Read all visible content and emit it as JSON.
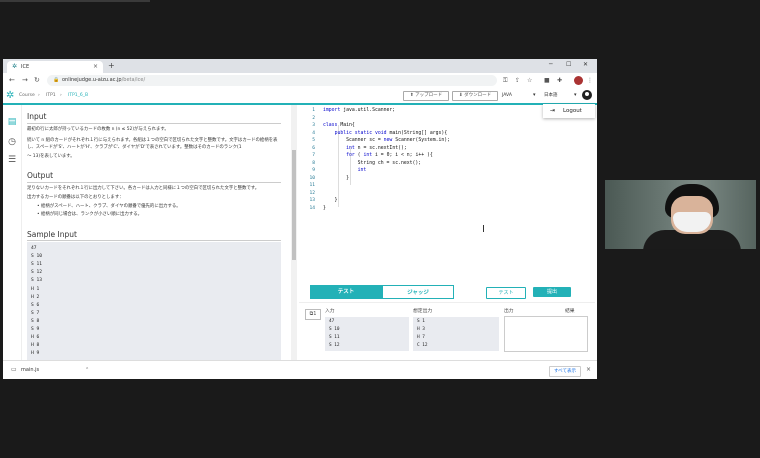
{
  "browser": {
    "tab_title": "ICE",
    "url_host": "onlinejudge.u-aizu.ac.jp",
    "url_path": "/beta/ice/",
    "new_tab": "+",
    "tab_close": "×"
  },
  "app": {
    "breadcrumbs": [
      "Course",
      "ITP1",
      "ITP1_6_B"
    ],
    "upload_label": "アップロード",
    "download_label": "ダウンロード",
    "language": "JAVA",
    "ui_language": "日本語",
    "logout_label": "Logout"
  },
  "problem": {
    "input_heading": "Input",
    "input_text_1": "最初の行に太郎が持っているカードの枚数 n (n ≤ 52)が与えられます。",
    "input_text_2": "続いて n 組のカードがそれぞれ１行に与えられます。各組は１つの空白で区切られた文字と整数です。文字はカードの絵柄を表し、スペードが'S'、ハートが'H'、クラブが'C'、ダイヤが'D'で表されています。整数はそのカードのランク(1",
    "input_text_3": "〜 13)を表しています。",
    "output_heading": "Output",
    "output_text_1": "足りないカードをそれぞれ１行に出力して下さい。各カードは入力と同様に１つの空白で区切られた文字と整数です。",
    "output_text_2": "出力するカードの順番は以下のとおりとします：",
    "bullets": [
      "絵柄がスペード、ハート、クラブ、ダイヤの順番で優先的に出力する。",
      "絵柄が同じ場合は、ランクが小さい順に出力する。"
    ],
    "sample_heading": "Sample Input",
    "sample_lines": [
      "47",
      "S 10",
      "S 11",
      "S 12",
      "S 13",
      "H 1",
      "H 2",
      "S 6",
      "S 7",
      "S 8",
      "S 9",
      "H 6",
      "H 8",
      "H 9"
    ]
  },
  "editor": {
    "line_numbers": [
      "1",
      "2",
      "3",
      "4",
      "5",
      "6",
      "7",
      "8",
      "9",
      "10",
      "11",
      "12",
      "13",
      "14"
    ],
    "lines": [
      "import java.util.Scanner;",
      "",
      "class Main{",
      "    public static void main(String[] args){",
      "        Scanner sc = new Scanner(System.in);",
      "        int n = sc.nextInt();",
      "        for ( int i = 0; i < n; i++ ){",
      "            String ch = sc.next();",
      "            int ",
      "        }",
      "",
      "",
      "    }",
      "}"
    ]
  },
  "panel": {
    "tab_test": "テスト",
    "tab_judge": "ジャッジ",
    "test_button": "テスト",
    "submit_button": "提出",
    "copy_label": "1",
    "input_label": "入力",
    "expected_label": "想定出力",
    "output_label": "出力",
    "result_label": "結果",
    "input_lines": [
      "47",
      "S 10",
      "S 11",
      "S 12"
    ],
    "expected_lines": [
      "S 1",
      "H 3",
      "H 7",
      "C 12"
    ]
  },
  "download_bar": {
    "file_name": "main.js",
    "show_all": "すべて表示",
    "close": "×"
  },
  "colors": {
    "accent": "#23b1b7",
    "keyword": "#0000cc",
    "line_number": "#237893"
  }
}
